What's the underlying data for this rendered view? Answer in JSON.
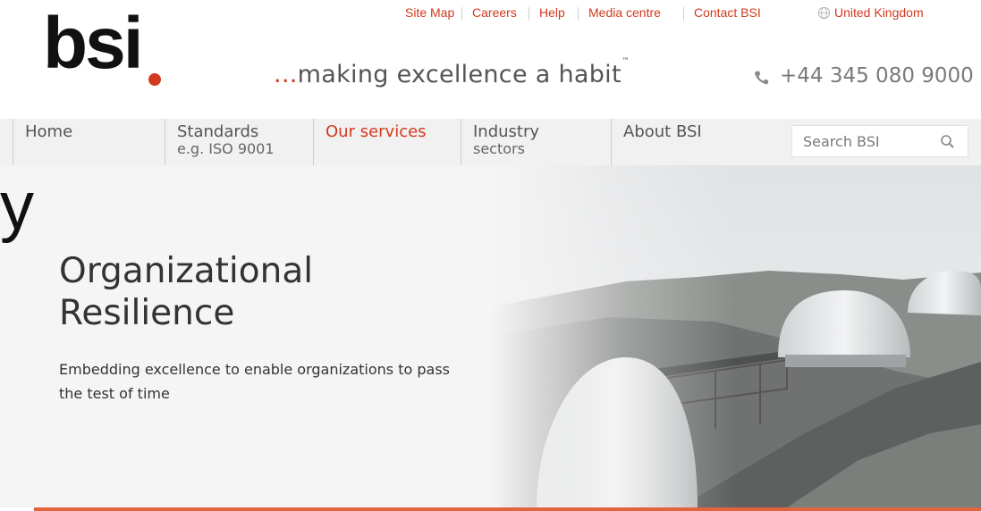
{
  "top_links": [
    "Site Map",
    "Careers",
    "Help",
    "Media centre",
    "Contact BSI"
  ],
  "region": "United Kingdom",
  "logo_text": "bsi",
  "tagline": {
    "prefix": "...",
    "text": "making excellence a habit",
    "tm": "™"
  },
  "phone": "+44 345 080 9000",
  "nav": [
    {
      "label": "Home",
      "sub": ""
    },
    {
      "label": "Standards",
      "sub": "e.g. ISO 9001"
    },
    {
      "label": "Our services",
      "sub": ""
    },
    {
      "label": "Industry",
      "sub": "sectors"
    },
    {
      "label": "About BSI",
      "sub": ""
    }
  ],
  "search": {
    "placeholder": "Search BSI"
  },
  "hero": {
    "edge_char": "y",
    "title_line1": "Organizational",
    "title_line2": "Resilience",
    "description": "Embedding excellence to enable organizations to pass the test of time"
  },
  "colors": {
    "accent": "#d2391f",
    "bar": "#e2643f"
  },
  "icons": [
    "globe-icon",
    "phone-icon",
    "search-icon"
  ]
}
